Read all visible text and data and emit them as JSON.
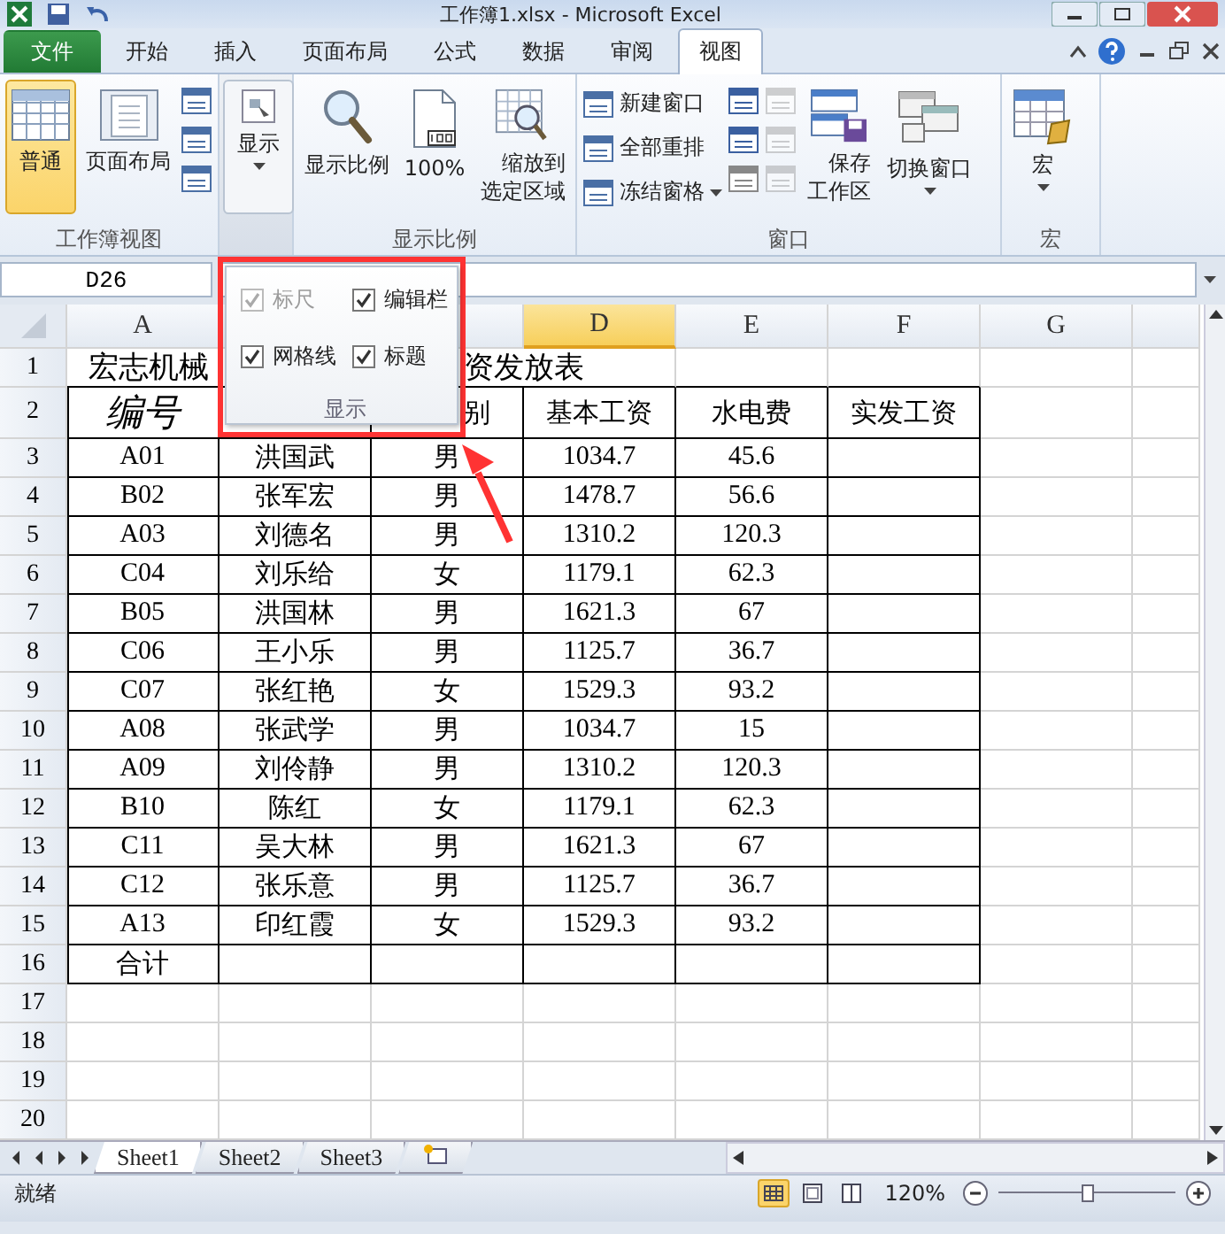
{
  "title_bar": {
    "title": "工作簿1.xlsx - Microsoft Excel"
  },
  "ribbon_tabs": [
    {
      "label": "文件",
      "kind": "file",
      "selected": false
    },
    {
      "label": "开始",
      "kind": "tab",
      "selected": false
    },
    {
      "label": "插入",
      "kind": "tab",
      "selected": false
    },
    {
      "label": "页面布局",
      "kind": "tab",
      "selected": false
    },
    {
      "label": "公式",
      "kind": "tab",
      "selected": false
    },
    {
      "label": "数据",
      "kind": "tab",
      "selected": false
    },
    {
      "label": "审阅",
      "kind": "tab",
      "selected": false
    },
    {
      "label": "视图",
      "kind": "tab",
      "selected": true
    }
  ],
  "ribbon": {
    "workbook_views": {
      "title": "工作簿视图",
      "buttons": [
        {
          "label": "普通",
          "kind": "normal",
          "selected": true
        },
        {
          "label": "页面布局",
          "kind": "page",
          "selected": false
        }
      ]
    },
    "show": {
      "label": "显示",
      "pressed": true
    },
    "zoom": {
      "title": "显示比例",
      "buttons": [
        {
          "label": "显示比例",
          "kind": "magnifier"
        },
        {
          "label": "100%",
          "kind": "page100"
        },
        {
          "label": "缩放到选定区域",
          "kind": "zoom_selection"
        }
      ]
    },
    "window": {
      "title": "窗口",
      "commands": [
        {
          "label": "新建窗口",
          "dropdown": false
        },
        {
          "label": "全部重排",
          "dropdown": false
        },
        {
          "label": "冻结窗格",
          "dropdown": true
        }
      ],
      "buttons": [
        {
          "label": "保存工作区",
          "kind": "save",
          "dropdown": false
        },
        {
          "label": "切换窗口",
          "kind": "switch",
          "dropdown": true
        }
      ]
    },
    "macros": {
      "title": "宏",
      "label": "宏",
      "dropdown": true
    }
  },
  "formula_bar": {
    "name_box": "D26"
  },
  "sheet": {
    "columns": [
      {
        "label": "A",
        "selected": false
      },
      {
        "selected": false
      },
      {
        "selected": false
      },
      {
        "label": "D",
        "selected": true
      },
      {
        "label": "E",
        "selected": false
      },
      {
        "label": "F",
        "selected": false
      },
      {
        "label": "G",
        "selected": false
      }
    ],
    "rows": [
      {
        "number": "1",
        "kind": "title",
        "texts": [
          "宏志机械",
          "资发放表"
        ]
      },
      {
        "number": "2",
        "kind": "header",
        "first": "编号",
        "covered_part": "别",
        "rest": [
          "基本工资",
          "水电费",
          "实发工资"
        ]
      },
      {
        "number": "3",
        "kind": "data",
        "cells": [
          "A01",
          "洪国武",
          "男",
          "1034.7",
          "45.6"
        ]
      },
      {
        "number": "4",
        "kind": "data",
        "cells": [
          "B02",
          "张军宏",
          "男",
          "1478.7",
          "56.6"
        ]
      },
      {
        "number": "5",
        "kind": "data",
        "cells": [
          "A03",
          "刘德名",
          "男",
          "1310.2",
          "120.3"
        ]
      },
      {
        "number": "6",
        "kind": "data",
        "cells": [
          "C04",
          "刘乐给",
          "女",
          "1179.1",
          "62.3"
        ]
      },
      {
        "number": "7",
        "kind": "data",
        "cells": [
          "B05",
          "洪国林",
          "男",
          "1621.3",
          "67"
        ]
      },
      {
        "number": "8",
        "kind": "data",
        "cells": [
          "C06",
          "王小乐",
          "男",
          "1125.7",
          "36.7"
        ]
      },
      {
        "number": "9",
        "kind": "data",
        "cells": [
          "C07",
          "张红艳",
          "女",
          "1529.3",
          "93.2"
        ]
      },
      {
        "number": "10",
        "kind": "data",
        "cells": [
          "A08",
          "张武学",
          "男",
          "1034.7",
          "15"
        ]
      },
      {
        "number": "11",
        "kind": "data",
        "cells": [
          "A09",
          "刘伶静",
          "男",
          "1310.2",
          "120.3"
        ]
      },
      {
        "number": "12",
        "kind": "data",
        "cells": [
          "B10",
          "陈红",
          "女",
          "1179.1",
          "62.3"
        ]
      },
      {
        "number": "13",
        "kind": "data",
        "cells": [
          "C11",
          "吴大林",
          "男",
          "1621.3",
          "67"
        ]
      },
      {
        "number": "14",
        "kind": "data",
        "cells": [
          "C12",
          "张乐意",
          "男",
          "1125.7",
          "36.7"
        ]
      },
      {
        "number": "15",
        "kind": "data",
        "cells": [
          "A13",
          "印红霞",
          "女",
          "1529.3",
          "93.2"
        ]
      },
      {
        "number": "16",
        "kind": "data",
        "cells": [
          "合计"
        ]
      },
      {
        "number": "17",
        "kind": "empty"
      },
      {
        "number": "18",
        "kind": "empty"
      },
      {
        "number": "19",
        "kind": "empty"
      },
      {
        "number": "20",
        "kind": "empty"
      }
    ]
  },
  "show_popup": {
    "options": [
      {
        "label": "标尺",
        "checked": true,
        "disabled": true
      },
      {
        "label": "编辑栏",
        "checked": true,
        "disabled": false
      },
      {
        "label": "网格线",
        "checked": true,
        "disabled": false
      },
      {
        "label": "标题",
        "checked": true,
        "disabled": false
      }
    ],
    "title": "显示"
  },
  "sheet_tabs": [
    {
      "label": "Sheet1",
      "selected": true
    },
    {
      "label": "Sheet2",
      "selected": false
    },
    {
      "label": "Sheet3",
      "selected": false
    }
  ],
  "status_bar": {
    "status": "就绪",
    "view_buttons": [
      {
        "kind": "normal",
        "selected": true
      },
      {
        "kind": "page_layout",
        "selected": false
      },
      {
        "kind": "page_break",
        "selected": false
      }
    ],
    "zoom": "120%",
    "zoom_slider": {
      "level": 0.5
    }
  }
}
